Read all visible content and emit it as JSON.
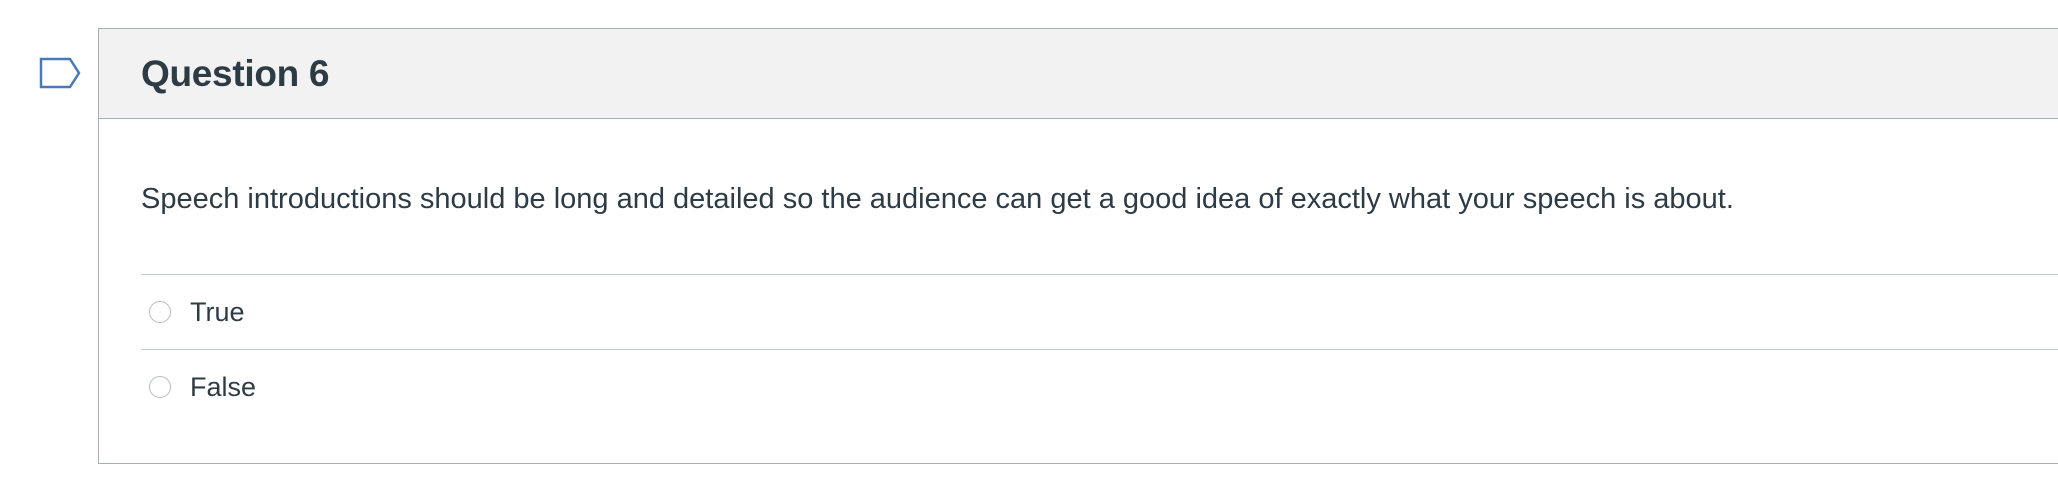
{
  "question": {
    "title": "Question 6",
    "text": "Speech introductions should be long and detailed so the audience can get a good idea of exactly what your speech is about.",
    "flag_icon": "bookmark-flag-icon",
    "answers": [
      {
        "label": "True",
        "selected": false
      },
      {
        "label": "False",
        "selected": false
      }
    ]
  },
  "colors": {
    "text": "#2d3b45",
    "header_bg": "#f2f2f2",
    "border": "#a5afb5",
    "flag": "#4a7ab5"
  }
}
